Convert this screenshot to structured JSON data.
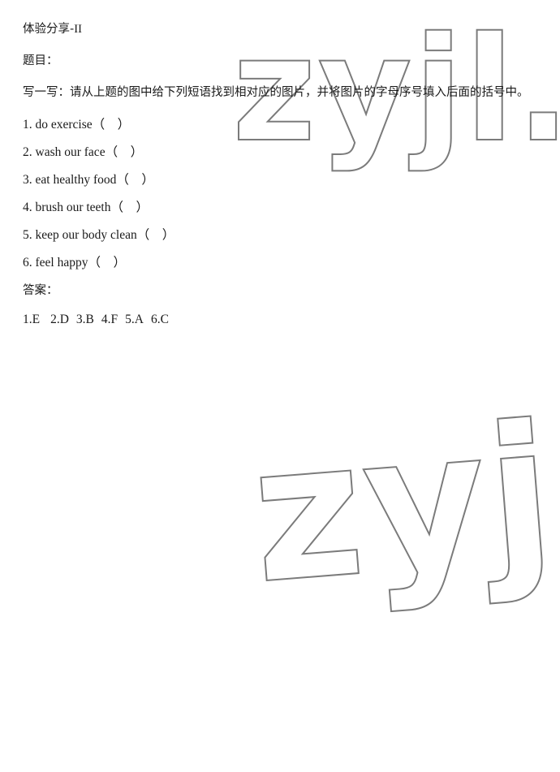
{
  "document": {
    "title_cn": "体验分享",
    "title_suffix": "-",
    "title_roman": "II",
    "section_label": "题目：",
    "prompt": "写一写：请从上题的图中给下列短语找到相对应的图片，并将图片的字母序号填入后面的括号中。",
    "questions": [
      {
        "number": "1.",
        "text": "do exercise",
        "blank": "（　）"
      },
      {
        "number": "2.",
        "text": "wash our face",
        "blank": "（　）"
      },
      {
        "number": "3.",
        "text": "eat healthy food",
        "blank": "（　）"
      },
      {
        "number": "4.",
        "text": "brush our teeth",
        "blank": "（　）"
      },
      {
        "number": "5.",
        "text": "keep our body clean",
        "blank": "（　）"
      },
      {
        "number": "6.",
        "text": "feel happy",
        "blank": "（　）"
      }
    ],
    "answer_label": "答案：",
    "answers": [
      "1.E",
      "2.D",
      "3.B",
      "4.F",
      "5.A",
      "6.C"
    ]
  },
  "watermark": {
    "top_text": "zyjl.cn",
    "bottom_text": "zyjl.cn",
    "color": "#7b7b7b"
  }
}
